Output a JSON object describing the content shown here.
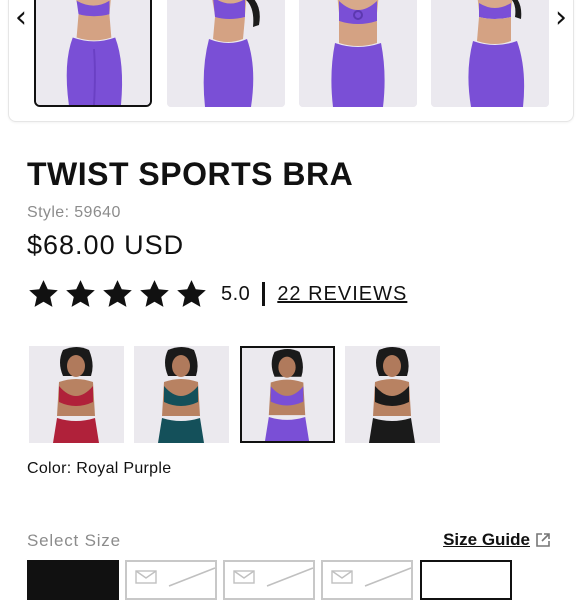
{
  "carousel": {
    "prev_icon": "chevron-left-icon",
    "next_icon": "chevron-right-icon",
    "prev_glyph": "‹",
    "next_glyph": "›"
  },
  "product": {
    "title": "TWIST SPORTS BRA",
    "style": "Style: 59640",
    "price": "$68.00 USD",
    "rating": {
      "stars": 5,
      "max_stars": 5,
      "value": "5.0",
      "reviews_link": "22 REVIEWS"
    }
  },
  "colors": {
    "options": [
      {
        "name": "Red",
        "swatch": "#b0213a"
      },
      {
        "name": "Teal",
        "swatch": "#14505a"
      },
      {
        "name": "Royal Purple",
        "swatch": "#7a4fd6"
      },
      {
        "name": "Black",
        "swatch": "#1a1a1a"
      }
    ],
    "selected_index": 2,
    "label": "Color: Royal Purple"
  },
  "size": {
    "label": "Select Size",
    "guide_link": "Size Guide",
    "guide_icon": "external-link-icon"
  },
  "theme": {
    "accent": "#111111",
    "muted": "#8c8c8c",
    "purple": "#7a4fd6",
    "thumb_bg": "#ebe9ef"
  }
}
